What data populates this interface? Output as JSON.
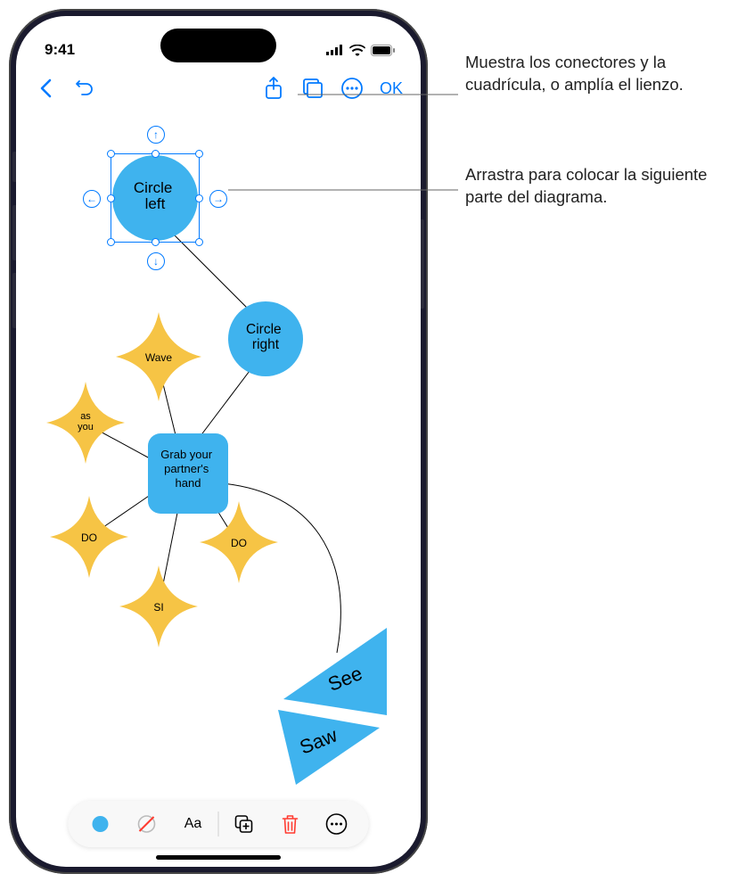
{
  "status": {
    "time": "9:41"
  },
  "toolbar": {
    "ok_label": "OK"
  },
  "callouts": {
    "c1": "Muestra los conectores y la cuadrícula, o amplía el lienzo.",
    "c2": "Arrastra para colocar la siguiente parte del diagrama."
  },
  "shapes": {
    "circle_left": "Circle left",
    "circle_right": "Circle right",
    "wave": "Wave",
    "as_you": "as you",
    "grab": "Grab your partner's hand",
    "do1": "DO",
    "do2": "DO",
    "si": "SI",
    "see": "See",
    "saw": "Saw"
  },
  "bottom_toolbar": {
    "text_label": "Aa"
  },
  "colors": {
    "accent": "#007aff",
    "shape_blue": "#3fb3ee",
    "shape_yellow": "#f6c445",
    "trash": "#ff3b30"
  }
}
